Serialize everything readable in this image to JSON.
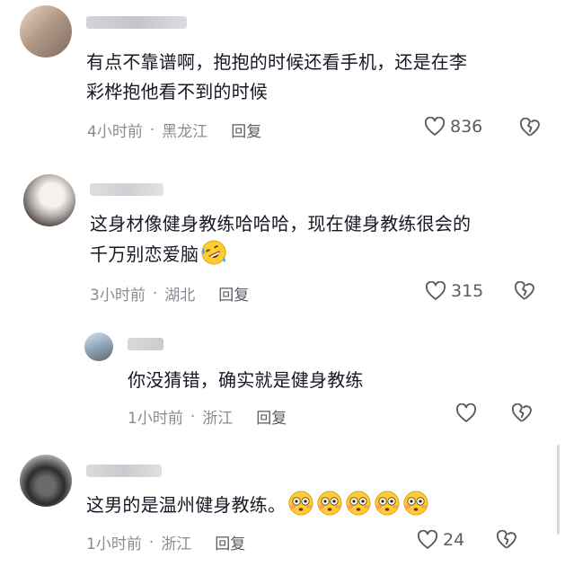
{
  "comments": [
    {
      "text_lines": [
        "有点不靠谱啊，抱抱的时候还看手机，还是在李",
        "彩桦抱他看不到的时候"
      ],
      "time": "4小时前",
      "location": "黑龙江",
      "reply_label": "回复",
      "likes": "836"
    },
    {
      "text_lines": [
        "这身材像健身教练哈哈哈，现在健身教练很会的",
        "千万别恋爱脑"
      ],
      "emoji": "rofl-emoji",
      "time": "3小时前",
      "location": "湖北",
      "reply_label": "回复",
      "likes": "315"
    },
    {
      "text_lines": [
        "你没猜错，确实就是健身教练"
      ],
      "time": "1小时前",
      "location": "浙江",
      "reply_label": "回复",
      "likes": ""
    },
    {
      "text_lines": [
        "这男的是温州健身教练。"
      ],
      "emoji": "flushed-emoji",
      "emoji_count": 5,
      "time": "1小时前",
      "location": "浙江",
      "reply_label": "回复",
      "likes": "24"
    }
  ],
  "colors": {
    "text": "#161823",
    "meta": "#8a8b91",
    "icon": "#5b5c63"
  },
  "icons": [
    "heart-outline-icon",
    "broken-heart-icon"
  ]
}
